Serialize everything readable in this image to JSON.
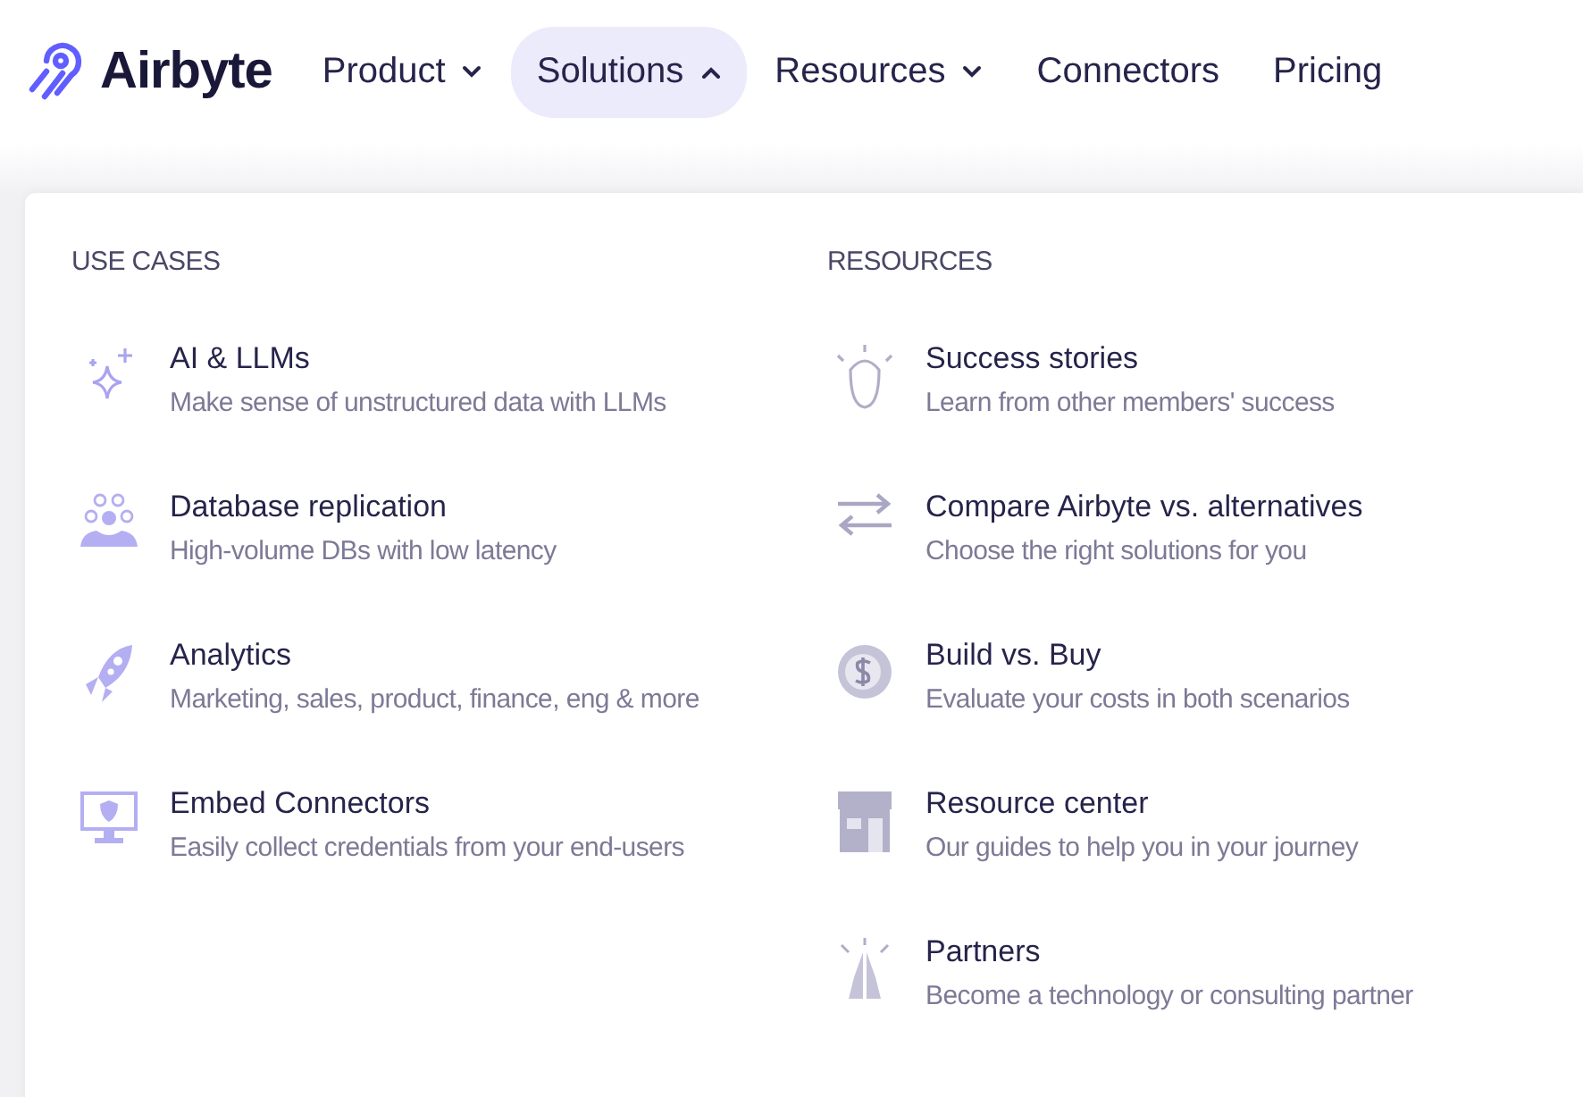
{
  "brand": {
    "name": "Airbyte"
  },
  "nav": [
    {
      "label": "Product",
      "kind": "dropdown",
      "expanded": false,
      "selected": false
    },
    {
      "label": "Solutions",
      "kind": "dropdown",
      "expanded": true,
      "selected": true
    },
    {
      "label": "Resources",
      "kind": "dropdown",
      "expanded": false,
      "selected": false
    },
    {
      "label": "Connectors",
      "kind": "link",
      "selected": false
    },
    {
      "label": "Pricing",
      "kind": "link",
      "selected": false
    }
  ],
  "menu": {
    "columns": [
      {
        "heading": "USE CASES",
        "items": [
          {
            "kind": "sparkle",
            "title": "AI & LLMs",
            "description": "Make sense of unstructured data with LLMs"
          },
          {
            "kind": "people",
            "title": "Database replication",
            "description": "High-volume DBs with low latency"
          },
          {
            "kind": "rocket",
            "title": "Analytics",
            "description": "Marketing, sales, product, finance, eng & more"
          },
          {
            "kind": "monitor",
            "title": "Embed Connectors",
            "description": "Easily collect credentials from your end-users"
          }
        ]
      },
      {
        "heading": "RESOURCES",
        "items": [
          {
            "kind": "person",
            "title": "Success stories",
            "description": "Learn from other members' success"
          },
          {
            "kind": "arrows",
            "title": "Compare Airbyte vs. alternatives",
            "description": "Choose the right solutions for you"
          },
          {
            "kind": "coin",
            "title": "Build vs. Buy",
            "description": "Evaluate your costs in both scenarios"
          },
          {
            "kind": "store",
            "title": "Resource center",
            "description": "Our guides to help you in your journey"
          },
          {
            "kind": "hands",
            "title": "Partners",
            "description": "Become a technology or consulting partner"
          }
        ]
      }
    ]
  }
}
